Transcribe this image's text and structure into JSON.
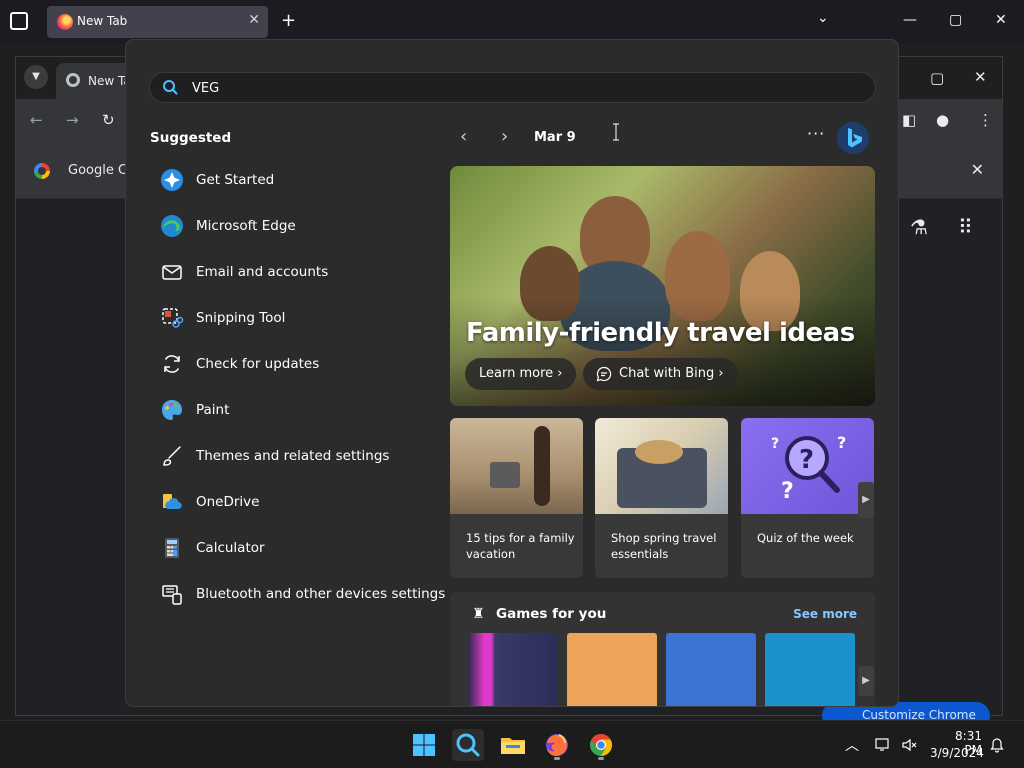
{
  "firefox": {
    "tab_title": "New Tab",
    "new_tab_label": "+",
    "tab_close": "✕",
    "chevron": "⌄",
    "minimize": "—",
    "maximize": "▢",
    "close": "✕"
  },
  "chrome": {
    "tab_title": "New Ta",
    "bookmark_text": "Google Ch",
    "bookmark_close": "✕",
    "customize_label": "Customize Chrome",
    "maximize": "▢",
    "close": "✕"
  },
  "search": {
    "value": "VEG",
    "placeholder": ""
  },
  "suggested": {
    "title": "Suggested",
    "items": [
      {
        "label": "Get Started",
        "icon": "get-started-icon"
      },
      {
        "label": "Microsoft Edge",
        "icon": "edge-icon"
      },
      {
        "label": "Email and accounts",
        "icon": "mail-icon"
      },
      {
        "label": "Snipping Tool",
        "icon": "snipping-tool-icon"
      },
      {
        "label": "Check for updates",
        "icon": "refresh-icon"
      },
      {
        "label": "Paint",
        "icon": "paint-icon"
      },
      {
        "label": "Themes and related settings",
        "icon": "brush-icon"
      },
      {
        "label": "OneDrive",
        "icon": "onedrive-icon"
      },
      {
        "label": "Calculator",
        "icon": "calculator-icon"
      },
      {
        "label": "Bluetooth and other devices settings",
        "icon": "bluetooth-devices-icon"
      }
    ]
  },
  "feed": {
    "date": "Mar 9",
    "prev": "‹",
    "next": "›",
    "more": "···",
    "hero": {
      "title": "Family-friendly travel ideas",
      "learn_more": "Learn more  ›",
      "chat_bing": "Chat with Bing  ›"
    },
    "cards": [
      {
        "text": "15 tips for a family vacation"
      },
      {
        "text": "Shop spring travel essentials"
      },
      {
        "text": "Quiz of the week"
      }
    ],
    "games": {
      "title": "Games for you",
      "see_more": "See more"
    }
  },
  "taskbar": {
    "time": "8:31 PM",
    "date": "3/9/2024",
    "tray_arrow": "︿",
    "bell": "🔔"
  },
  "colors": {
    "accent": "#0067c0",
    "link": "#8ac7ff",
    "panel": "#2b2b2b"
  }
}
